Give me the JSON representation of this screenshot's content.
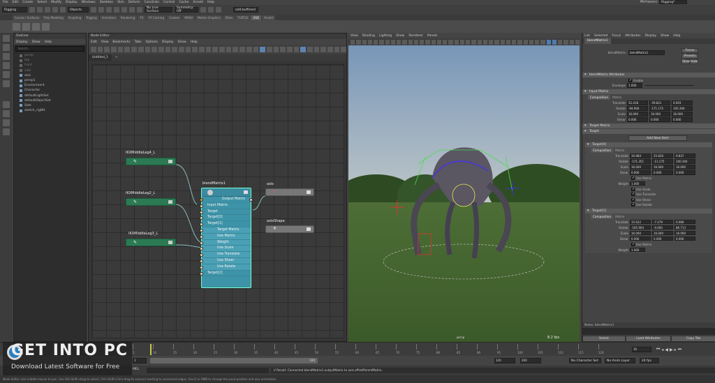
{
  "menubar": {
    "items": [
      "File",
      "Edit",
      "Create",
      "Select",
      "Modify",
      "Display",
      "Windows",
      "Skeleton",
      "Skin",
      "Deform",
      "Constrain",
      "Control",
      "Cache",
      "Arnold",
      "Help"
    ],
    "workspace_label": "Workspace:",
    "workspace_value": "Rigging*"
  },
  "toolbar": {
    "mode": "Rigging",
    "objects": "Objects",
    "live_surface": "No Live Surface",
    "symmetry": "Symmetry: Off",
    "camera": "add.buffered"
  },
  "shelf_tabs": [
    "Curves / Surfaces",
    "Poly Modeling",
    "Sculpting",
    "Rigging",
    "Animation",
    "Rendering",
    "FX",
    "FX Caching",
    "Custom",
    "MASH",
    "Motion Graphics",
    "XGen",
    "TURTLE",
    "USD",
    "Arnold"
  ],
  "shelf_active": "USD",
  "outliner": {
    "title": "Outliner",
    "menu": [
      "Display",
      "Show",
      "Help"
    ],
    "search_placeholder": "Search...",
    "items": [
      {
        "label": "persp",
        "dim": true
      },
      {
        "label": "top",
        "dim": true
      },
      {
        "label": "front",
        "dim": true
      },
      {
        "label": "side",
        "dim": true
      },
      {
        "label": "axis",
        "dim": false
      },
      {
        "label": "persp1",
        "dim": false
      },
      {
        "label": "Environment",
        "dim": false
      },
      {
        "label": "Character",
        "dim": false
      },
      {
        "label": "defaultLightSet",
        "dim": false
      },
      {
        "label": "defaultObjectSet",
        "dim": false
      },
      {
        "label": "Sets",
        "dim": false
      },
      {
        "label": "sketch_rigBtt",
        "dim": false
      }
    ]
  },
  "node_editor": {
    "title": "Node Editor",
    "menu": [
      "Edit",
      "View",
      "Bookmarks",
      "Tabs",
      "Options",
      "Display",
      "Show",
      "Help"
    ],
    "tab": "Untitled_1"
  },
  "nodes": {
    "leg4": "IKXMiddleLeg4_L",
    "leg2": "IKXMiddleLeg2_L",
    "leg3": "IKXMiddleLeg3_L",
    "blend": "blendMatrix1",
    "axis": "axis",
    "axis_shape": "axisShape",
    "blend_rows": [
      {
        "label": "Output Matrix",
        "sub": false,
        "align": "right"
      },
      {
        "label": "Input Matrix",
        "sub": false,
        "align": "left"
      },
      {
        "label": "Target",
        "sub": false,
        "align": "left"
      },
      {
        "label": "Target[0]",
        "sub": false,
        "align": "left"
      },
      {
        "label": "Target[1]",
        "sub": false,
        "align": "left"
      },
      {
        "label": "Target Matrix",
        "sub": true,
        "align": "left"
      },
      {
        "label": "Use Matrix",
        "sub": true,
        "align": "left"
      },
      {
        "label": "Weight",
        "sub": true,
        "align": "left"
      },
      {
        "label": "Use Scale",
        "sub": true,
        "align": "left"
      },
      {
        "label": "Use Translate",
        "sub": true,
        "align": "left"
      },
      {
        "label": "Use Shear",
        "sub": true,
        "align": "left"
      },
      {
        "label": "Use Rotate",
        "sub": true,
        "align": "left"
      },
      {
        "label": "Target[2]",
        "sub": false,
        "align": "left"
      }
    ]
  },
  "viewport": {
    "menu": [
      "View",
      "Shading",
      "Lighting",
      "Show",
      "Renderer",
      "Panels"
    ],
    "fps": "8.2 fps",
    "camera": "persp"
  },
  "attr_editor": {
    "menu": [
      "List",
      "Selected",
      "Focus",
      "Attributes",
      "Display",
      "Show",
      "Help"
    ],
    "node_tab": "blendMatrix1",
    "name_label": "blendMatrix:",
    "name_value": "blendMatrix1",
    "focus_btn": "Focus",
    "presets_btn": "Presets",
    "show_btn": "Show",
    "hide_btn": "Hide",
    "section_attrs": "blendMatrix Attributes",
    "enable_label": "Enable",
    "envelope_label": "Envelope",
    "envelope": "1.000",
    "input_matrix": "Input Matrix",
    "composition": "Composition",
    "matrix": "Matrix",
    "im": {
      "translate": [
        "52.418",
        "-59.821",
        "0.003"
      ],
      "rotate": [
        "-94.904",
        "-171.175",
        "105.304"
      ],
      "scale": [
        "16.000",
        "16.000",
        "16.000"
      ],
      "shear": [
        "0.000",
        "0.000",
        "0.000"
      ]
    },
    "target_matrix": "Target Matrix",
    "target": "Target",
    "add_new": "Add New Item",
    "t0": "Target[0]",
    "t0v": {
      "translate": [
        "10.084",
        "25.626",
        "9.837"
      ],
      "rotate": [
        "-171.351",
        "-11.175",
        "100.304"
      ],
      "scale": [
        "16.000",
        "16.000",
        "16.000"
      ],
      "shear": [
        "0.000",
        "0.000",
        "0.000"
      ]
    },
    "use_matrix": "Use Matrix",
    "weight_label": "Weight",
    "weight": "1.000",
    "use_scale": "Use Scale",
    "use_translate": "Use Translate",
    "use_shear": "Use Shear",
    "use_rotate": "Use Rotate",
    "t1": "Target[1]",
    "t1v": {
      "translate": [
        "15.622",
        "-7.279",
        "0.066"
      ],
      "rotate": [
        "-165.904",
        "-0.000",
        "86.713"
      ],
      "scale": [
        "16.000",
        "16.000",
        "16.000"
      ],
      "shear": [
        "0.000",
        "0.000",
        "0.000"
      ]
    },
    "labels": {
      "translate": "Translate",
      "rotate": "Rotate",
      "scale": "Scale",
      "shear": "Shear"
    },
    "notes_label": "Notes: blendMatrix1",
    "select_btn": "Select",
    "load_btn": "Load Attributes",
    "copy_btn": "Copy Tab"
  },
  "timeline": {
    "ticks": [
      "5",
      "10",
      "15",
      "20",
      "25",
      "30",
      "35",
      "40",
      "45",
      "50",
      "55",
      "60",
      "65",
      "70",
      "75",
      "80",
      "85",
      "90",
      "95",
      "100",
      "105",
      "110",
      "115",
      "120"
    ],
    "current": "16",
    "start": "1",
    "end": "120",
    "range_end": "200",
    "anim_end": "100",
    "char_set": "No Character Set",
    "anim_layer": "No Anim Layer",
    "fps": "24 fps"
  },
  "command": {
    "label": "MEL",
    "result": "// Result: Connected blendMatrix1.outputMatrix to axis.offsetParentMatrix."
  },
  "help": "Node Editor: Use middle-mouse to pan. Use Alt+Shift+drag to select, Ctrl+Shift+Ctrl+drag to connect existing to connected edges. Use D or RMB to change the pivot position and axis orientation.",
  "watermark": {
    "main": "GET INTO PC",
    "sub": "Download Latest Software for Free"
  },
  "colors": {
    "node_green": "#2b7a53",
    "node_teal": "#3d93a8",
    "select_blue": "#5d83b0"
  }
}
